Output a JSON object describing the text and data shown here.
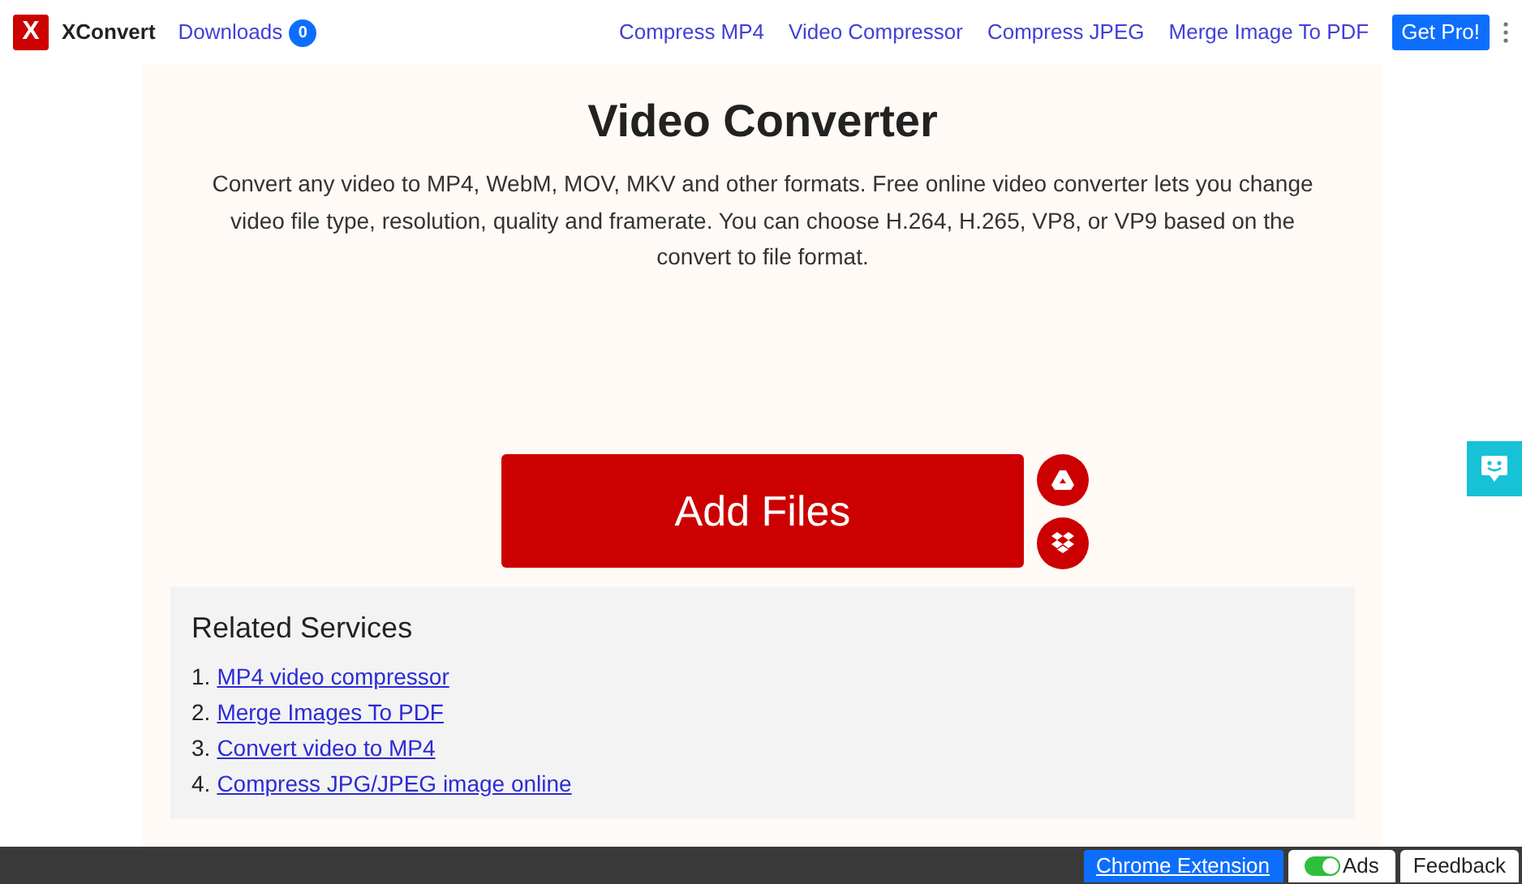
{
  "header": {
    "logo_mark": "X",
    "brand": "XConvert",
    "downloads": {
      "label": "Downloads",
      "count": "0"
    },
    "nav": [
      "Compress MP4",
      "Video Compressor",
      "Compress JPEG",
      "Merge Image To PDF"
    ],
    "cta": "Get Pro!"
  },
  "main": {
    "title": "Video Converter",
    "description": "Convert any video to MP4, WebM, MOV, MKV and other formats. Free online video converter lets you change video file type, resolution, quality and framerate. You can choose H.264, H.265, VP8, or VP9 based on the convert to file format.",
    "add_button": "Add Files"
  },
  "related": {
    "heading": "Related Services",
    "items": [
      {
        "number": "1.",
        "label": "MP4 video compressor"
      },
      {
        "number": "2.",
        "label": "Merge Images To PDF"
      },
      {
        "number": "3.",
        "label": "Convert video to MP4"
      },
      {
        "number": "4.",
        "label": "Compress JPG/JPEG image online"
      }
    ]
  },
  "footer": {
    "extension": "Chrome Extension",
    "ads": {
      "label": "Ads",
      "on": true
    },
    "feedback": "Feedback"
  }
}
